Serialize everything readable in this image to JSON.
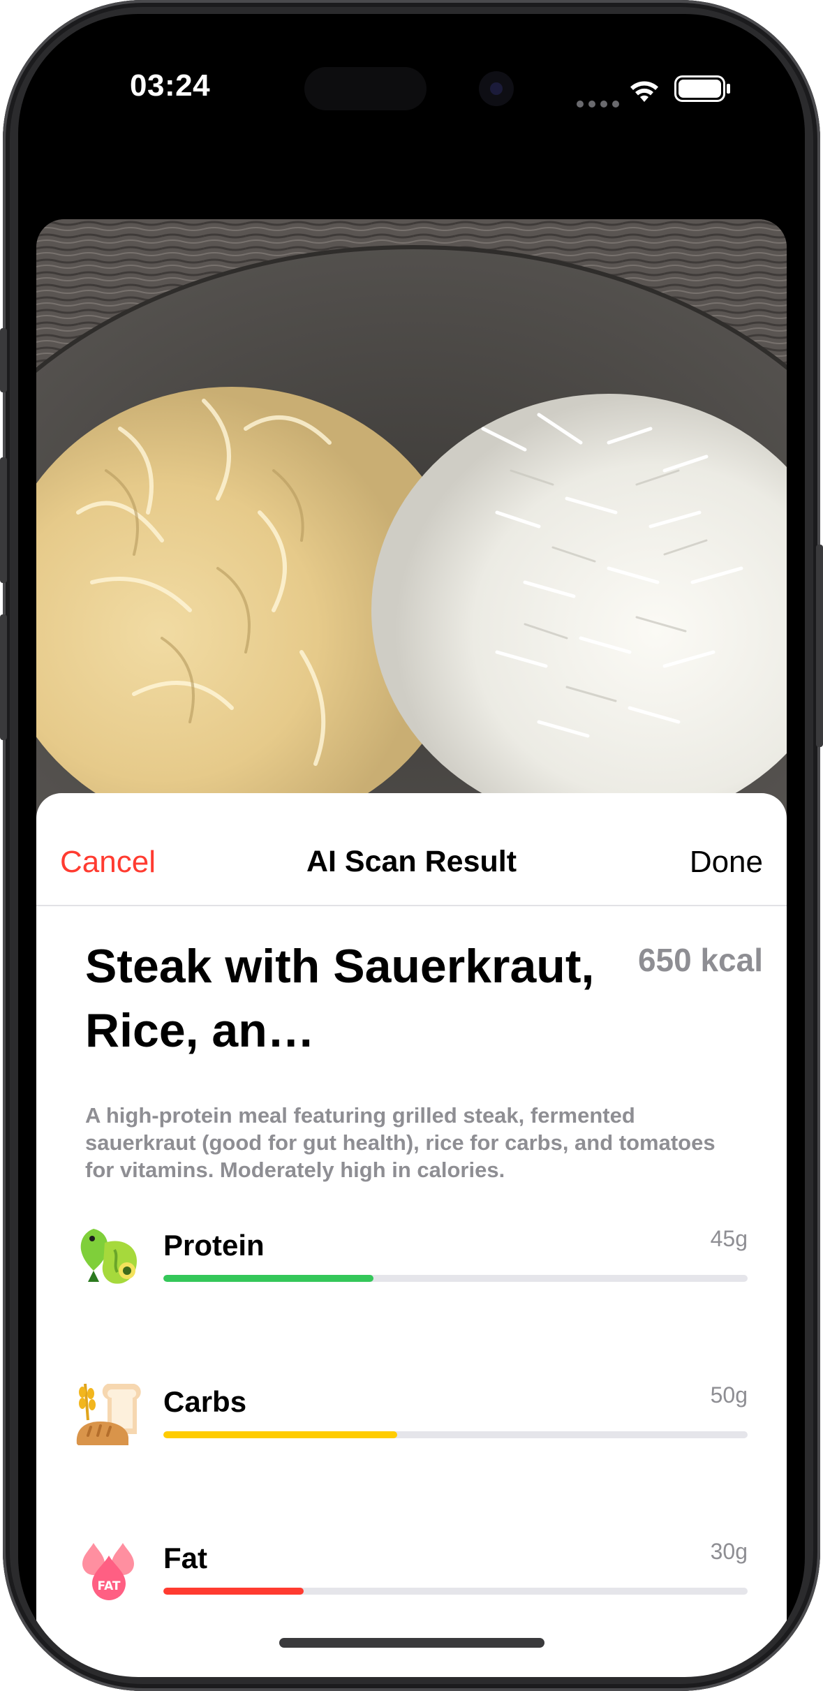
{
  "status_bar": {
    "time": "03:24"
  },
  "sheet": {
    "cancel_label": "Cancel",
    "title": "AI Scan Result",
    "done_label": "Done"
  },
  "meal": {
    "name": "Steak with Sauerkraut, Rice, an…",
    "calories": "650 kcal",
    "description": "A high-protein meal featuring grilled steak,  fermented sauerkraut (good for gut health), rice for carbs, and tomatoes for vitamins.  Moderately high in calories."
  },
  "macros": [
    {
      "label": "Protein",
      "value": "45g",
      "icon": "protein-food-icon",
      "color": "#34c759",
      "progress": 0.36
    },
    {
      "label": "Carbs",
      "value": "50g",
      "icon": "carbs-bread-icon",
      "color": "#ffcc00",
      "progress": 0.4
    },
    {
      "label": "Fat",
      "value": "30g",
      "icon": "fat-drops-icon",
      "color": "#ff3b30",
      "progress": 0.24
    }
  ],
  "colors": {
    "accent_cancel": "#ff3b30",
    "secondary_text": "#8e8e93"
  }
}
